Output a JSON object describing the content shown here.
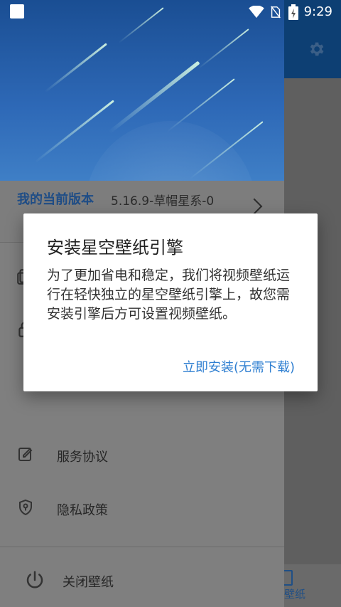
{
  "status_bar": {
    "time": "9:29"
  },
  "app": {
    "bottom_nav_label": "壁纸"
  },
  "drawer": {
    "version": {
      "title": "我的当前版本",
      "value": "5.16.9-草帽星系-0"
    },
    "items": [
      {
        "label": "服务协议",
        "icon": "edit-icon"
      },
      {
        "label": "隐私政策",
        "icon": "shield-icon"
      },
      {
        "label": "关闭壁纸",
        "icon": "power-icon"
      }
    ]
  },
  "dialog": {
    "title": "安装星空壁纸引擎",
    "message": "为了更加省电和稳定，我们将视频壁纸运行在轻快独立的星空壁纸引擎上，故您需安装引擎后方可设置视频壁纸。",
    "action": "立即安装(无需下载)"
  },
  "colors": {
    "accent": "#2f7fd1",
    "header_top": "#1a4e93",
    "header_bottom": "#3f7fc6",
    "drawer_dimmed": "#7f7f7f"
  }
}
